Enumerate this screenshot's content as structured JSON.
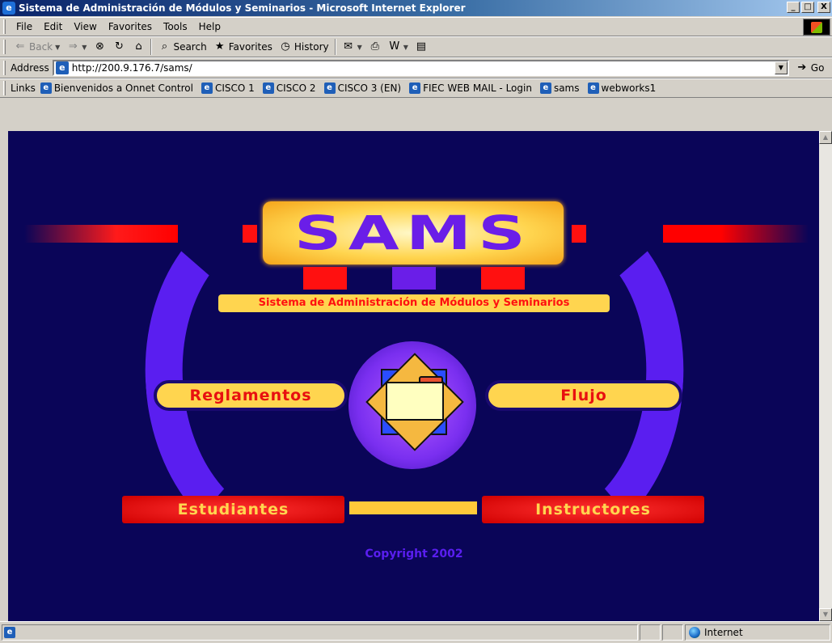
{
  "window": {
    "title": "Sistema de Administración de Módulos y Seminarios - Microsoft Internet Explorer",
    "controls": {
      "minimize": "_",
      "maximize": "□",
      "close": "X"
    }
  },
  "menu": [
    {
      "label": "File"
    },
    {
      "label": "Edit"
    },
    {
      "label": "View"
    },
    {
      "label": "Favorites"
    },
    {
      "label": "Tools"
    },
    {
      "label": "Help"
    }
  ],
  "toolbar": {
    "back": "Back",
    "search": "Search",
    "favorites": "Favorites",
    "history": "History"
  },
  "address": {
    "label": "Address",
    "url": "http://200.9.176.7/sams/",
    "go": "Go"
  },
  "links": {
    "label": "Links",
    "items": [
      {
        "label": "Bienvenidos a Onnet Control"
      },
      {
        "label": "CISCO 1"
      },
      {
        "label": "CISCO 2"
      },
      {
        "label": "CISCO 3 (EN)"
      },
      {
        "label": "FIEC WEB MAIL - Login"
      },
      {
        "label": "sams"
      },
      {
        "label": "webworks1"
      }
    ]
  },
  "page": {
    "logo": "SAMS",
    "subtitle": "Sistema de Administración de Módulos y Seminarios",
    "nav": {
      "reglamentos": "Reglamentos",
      "flujo": "Flujo",
      "estudiantes": "Estudiantes",
      "instructores": "Instructores"
    },
    "copyright": "Copyright 2002",
    "colors": {
      "background": "#0a0558",
      "accent_purple": "#5a1ef0",
      "accent_yellow": "#ffd54f",
      "accent_red": "#ff1010"
    }
  },
  "status": {
    "zone": "Internet"
  }
}
